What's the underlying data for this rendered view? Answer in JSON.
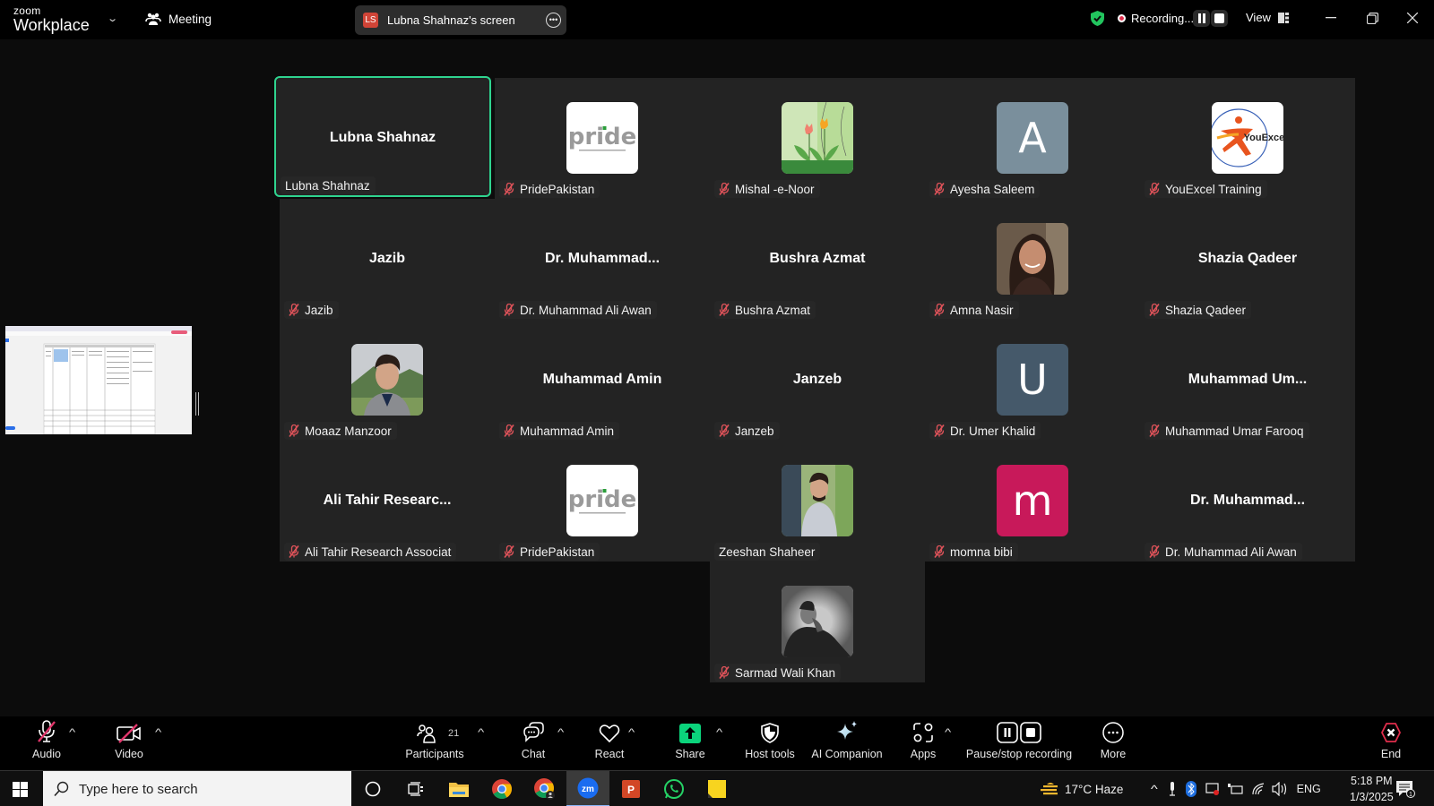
{
  "app": {
    "logo_top": "zoom",
    "logo_bottom": "Workplace",
    "meeting_label": "Meeting",
    "share_badge": "LS",
    "share_label": "Lubna Shahnaz's screen",
    "recording_label": "Recording...",
    "view_label": "View",
    "colors": {
      "active_speaker_border": "#2fd48f",
      "share_green": "#0bd47c",
      "muted_red": "#e0535a",
      "end_red": "#e02d4b"
    }
  },
  "participants": [
    {
      "display": "Lubna Shahnaz",
      "label": "Lubna Shahnaz",
      "avatar": "name",
      "muted": false,
      "active": true
    },
    {
      "display": "",
      "label": "PridePakistan",
      "avatar": "pride-logo",
      "muted": true
    },
    {
      "display": "",
      "label": "Mishal -e-Noor",
      "avatar": "tulips-image",
      "muted": true
    },
    {
      "display": "A",
      "label": "Ayesha Saleem",
      "avatar": "letter",
      "color": "#7a8f9c",
      "muted": true
    },
    {
      "display": "",
      "label": "YouExcel Training",
      "avatar": "youexcel-logo",
      "muted": true
    },
    {
      "display": "Jazib",
      "label": "Jazib",
      "avatar": "name",
      "muted": true
    },
    {
      "display": "Dr.  Muhammad...",
      "label": "Dr. Muhammad Ali Awan",
      "avatar": "name",
      "muted": true
    },
    {
      "display": "Bushra Azmat",
      "label": "Bushra Azmat",
      "avatar": "name",
      "muted": true
    },
    {
      "display": "",
      "label": "Amna Nasir",
      "avatar": "photo-woman",
      "muted": true
    },
    {
      "display": "Shazia Qadeer",
      "label": "Shazia Qadeer",
      "avatar": "name",
      "muted": true
    },
    {
      "display": "",
      "label": "Moaaz Manzoor",
      "avatar": "photo-man",
      "muted": true
    },
    {
      "display": "Muhammad Amin",
      "label": "Muhammad Amin",
      "avatar": "name",
      "muted": true
    },
    {
      "display": "Janzeb",
      "label": "Janzeb",
      "avatar": "name",
      "muted": true
    },
    {
      "display": "U",
      "label": "Dr. Umer Khalid",
      "avatar": "letter",
      "color": "#45596a",
      "muted": true
    },
    {
      "display": "Muhammad  Um...",
      "label": "Muhammad Umar Farooq",
      "avatar": "name",
      "muted": true
    },
    {
      "display": "Ali  Tahir  Researc...",
      "label": "Ali Tahir Research Associat",
      "avatar": "name",
      "muted": true
    },
    {
      "display": "",
      "label": "PridePakistan",
      "avatar": "pride-logo",
      "muted": true
    },
    {
      "display": "",
      "label": "Zeeshan Shaheer",
      "avatar": "photo-man-tree",
      "muted": false
    },
    {
      "display": "m",
      "label": "momna bibi",
      "avatar": "letter",
      "color": "#c8195a",
      "muted": true
    },
    {
      "display": "Dr.  Muhammad...",
      "label": "Dr. Muhammad Ali Awan",
      "avatar": "name",
      "muted": true
    },
    {
      "display": "",
      "label": "Sarmad Wali Khan",
      "avatar": "photo-bw",
      "muted": true
    }
  ],
  "pride_text": "pride",
  "youexcel_text": "YouExcel",
  "toolbar": {
    "audio": "Audio",
    "video": "Video",
    "participants": "Participants",
    "participants_count": "21",
    "chat": "Chat",
    "react": "React",
    "share": "Share",
    "host_tools": "Host tools",
    "ai_companion": "AI Companion",
    "apps": "Apps",
    "pause_stop_recording": "Pause/stop recording",
    "more": "More",
    "end": "End"
  },
  "taskbar": {
    "search_placeholder": "Type here to search",
    "weather": "17°C  Haze",
    "language": "ENG",
    "time": "5:18 PM",
    "date": "1/3/2025",
    "notification_count": "1"
  }
}
